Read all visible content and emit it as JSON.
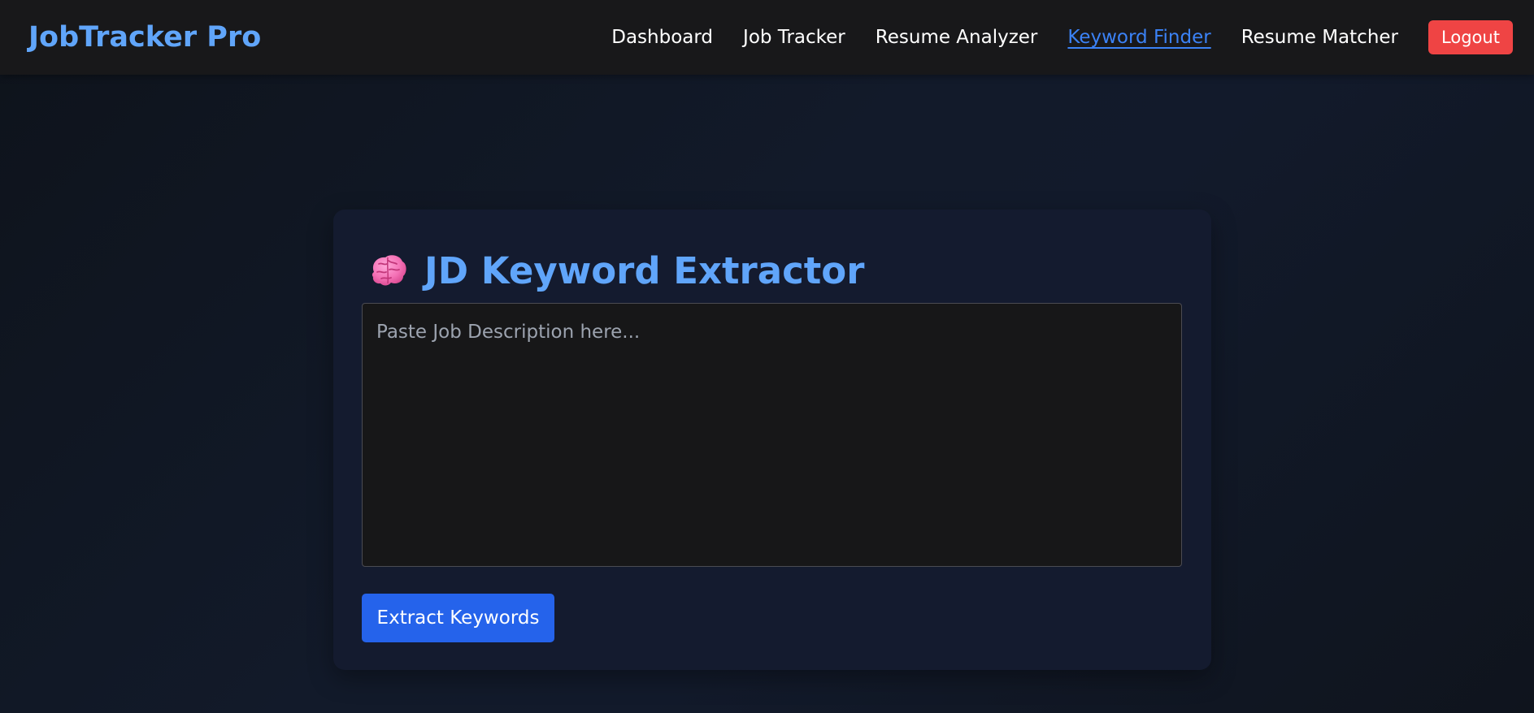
{
  "navbar": {
    "brand": "JobTracker Pro",
    "links": [
      {
        "label": "Dashboard",
        "active": false
      },
      {
        "label": "Job Tracker",
        "active": false
      },
      {
        "label": "Resume Analyzer",
        "active": false
      },
      {
        "label": "Keyword Finder",
        "active": true
      },
      {
        "label": "Resume Matcher",
        "active": false
      }
    ],
    "logout_label": "Logout"
  },
  "card": {
    "icon": "brain-icon",
    "title": "JD Keyword Extractor",
    "textarea": {
      "placeholder": "Paste Job Description here...",
      "value": ""
    },
    "extract_label": "Extract Keywords"
  },
  "colors": {
    "brand": "#60a5fa",
    "active_link": "#3b82f6",
    "logout": "#ef4444",
    "primary_button": "#2563eb",
    "navbar_bg": "#18181a",
    "card_bg": "#141b2f"
  }
}
